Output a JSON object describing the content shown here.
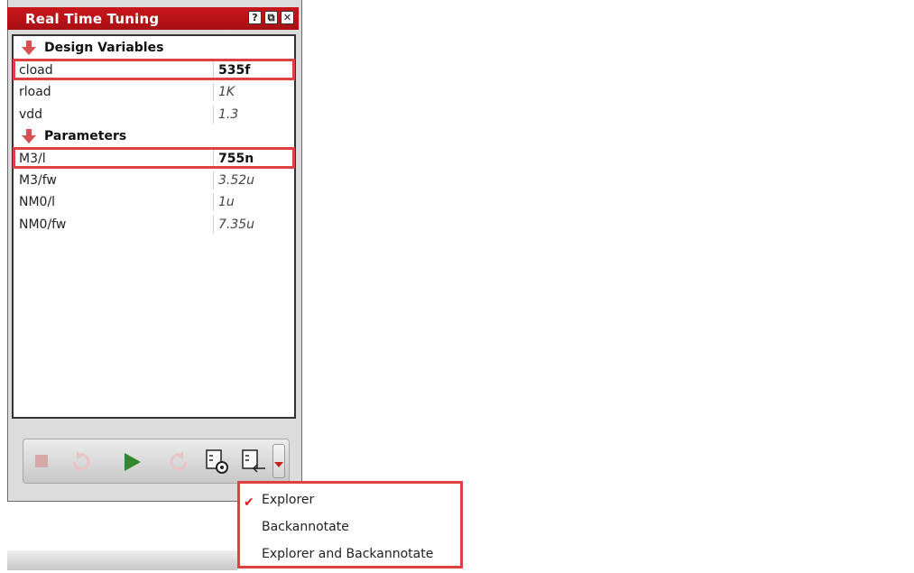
{
  "window": {
    "title": "Real Time Tuning",
    "buttons": {
      "help": "?",
      "restore": "⧉",
      "close": "✕"
    }
  },
  "tree": {
    "sections": [
      {
        "label": "Design Variables",
        "rows": [
          {
            "name": "cload",
            "value": "535f",
            "highlighted": true
          },
          {
            "name": "rload",
            "value": "1K",
            "highlighted": false
          },
          {
            "name": "vdd",
            "value": "1.3",
            "highlighted": false
          }
        ]
      },
      {
        "label": "Parameters",
        "rows": [
          {
            "name": "M3/l",
            "value": "755n",
            "highlighted": true
          },
          {
            "name": "M3/fw",
            "value": "3.52u",
            "highlighted": false
          },
          {
            "name": "NM0/l",
            "value": "1u",
            "highlighted": false
          },
          {
            "name": "NM0/fw",
            "value": "7.35u",
            "highlighted": false
          }
        ]
      }
    ]
  },
  "toolbar": {
    "icons": [
      "stop-icon",
      "undo-icon",
      "play-icon",
      "redo-icon",
      "explorer-icon",
      "backannotate-icon",
      "dropdown-arrow-icon"
    ]
  },
  "menu": {
    "items": [
      {
        "label": "Explorer",
        "checked": true
      },
      {
        "label": "Backannotate",
        "checked": false
      },
      {
        "label": "Explorer and Backannotate",
        "checked": false
      }
    ]
  },
  "colors": {
    "title_bar": "#b8131a",
    "highlight": "#e04040",
    "play": "#2f8a2f",
    "section_arrow": "#d85050"
  }
}
